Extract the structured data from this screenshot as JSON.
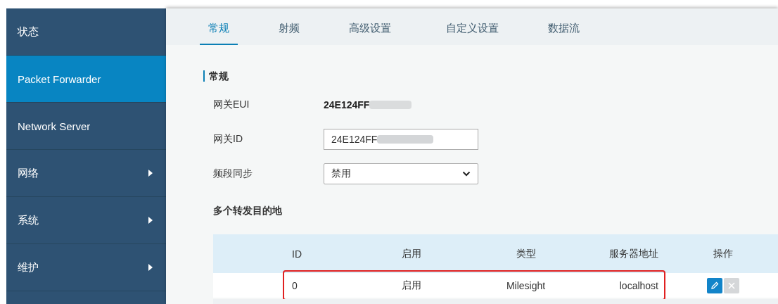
{
  "sidebar": {
    "items": [
      {
        "label": "状态",
        "selected": false,
        "expandable": false
      },
      {
        "label": "Packet Forwarder",
        "selected": true,
        "expandable": false
      },
      {
        "label": "Network Server",
        "selected": false,
        "expandable": false
      },
      {
        "label": "网络",
        "selected": false,
        "expandable": true
      },
      {
        "label": "系统",
        "selected": false,
        "expandable": true
      },
      {
        "label": "维护",
        "selected": false,
        "expandable": true
      }
    ]
  },
  "tabs": [
    {
      "label": "常规",
      "selected": true
    },
    {
      "label": "射频",
      "selected": false
    },
    {
      "label": "高级设置",
      "selected": false
    },
    {
      "label": "自定义设置",
      "selected": false
    },
    {
      "label": "数据流",
      "selected": false
    }
  ],
  "section": {
    "title": "常规"
  },
  "fields": [
    {
      "kind": "text",
      "label": "网关EUI",
      "value": "24E124FF"
    },
    {
      "kind": "input",
      "label": "网关ID",
      "value": "24E124FF"
    },
    {
      "kind": "select",
      "label": "频段同步",
      "value": "禁用"
    }
  ],
  "destinations": {
    "title": "多个转发目的地",
    "table": {
      "columns": [
        "ID",
        "启用",
        "类型",
        "服务器地址",
        "操作"
      ],
      "rows": [
        {
          "cells": [
            "0",
            "启用",
            "Milesight",
            "localhost"
          ],
          "highlighted": true,
          "actions": [
            {
              "kind": "edit",
              "disabled": false
            },
            {
              "kind": "delete",
              "disabled": true
            }
          ]
        }
      ]
    }
  }
}
